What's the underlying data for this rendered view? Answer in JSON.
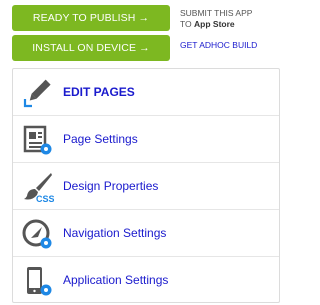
{
  "top": {
    "publish_label": "READY TO PUBLISH →",
    "install_label": "INSTALL ON DEVICE →",
    "submit_line1": "SUBMIT THIS APP",
    "submit_line2_prefix": "TO",
    "submit_line2_store": "App Store",
    "adhoc_label": "GET ADHOC BUILD"
  },
  "menu": {
    "items": [
      {
        "label": "EDIT PAGES",
        "icon": "pencil-icon"
      },
      {
        "label": "Page Settings",
        "icon": "page-settings-icon"
      },
      {
        "label": "Design Properties",
        "icon": "css-brush-icon"
      },
      {
        "label": "Navigation Settings",
        "icon": "navigation-gear-icon"
      },
      {
        "label": "Application Settings",
        "icon": "device-settings-icon"
      }
    ]
  },
  "colors": {
    "accent_green": "#7db821",
    "link_blue": "#1a1acd",
    "icon_grey": "#555555",
    "gear_blue": "#1e88e5"
  }
}
